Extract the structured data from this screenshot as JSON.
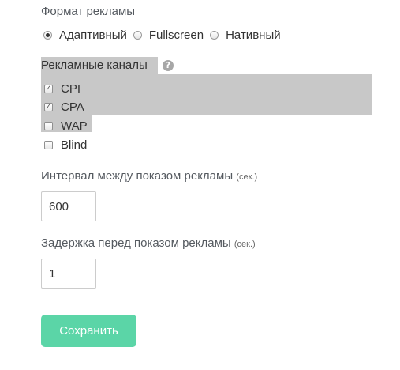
{
  "ad_format": {
    "title": "Формат рекламы",
    "options": [
      {
        "label": "Адаптивный",
        "checked": true
      },
      {
        "label": "Fullscreen",
        "checked": false
      },
      {
        "label": "Нативный",
        "checked": false
      }
    ]
  },
  "ad_channels": {
    "title": "Рекламные каналы",
    "help_icon": "?",
    "options": [
      {
        "label": "CPI",
        "checked": true
      },
      {
        "label": "CPA",
        "checked": true
      },
      {
        "label": "WAP",
        "checked": false
      },
      {
        "label": "Blind",
        "checked": false
      }
    ]
  },
  "interval": {
    "label": "Интервал между показом рекламы",
    "unit": "(сек.)",
    "value": "600"
  },
  "delay": {
    "label": "Задержка перед показом рекламы",
    "unit": "(сек.)",
    "value": "1"
  },
  "save_button": {
    "label": "Сохранить"
  }
}
